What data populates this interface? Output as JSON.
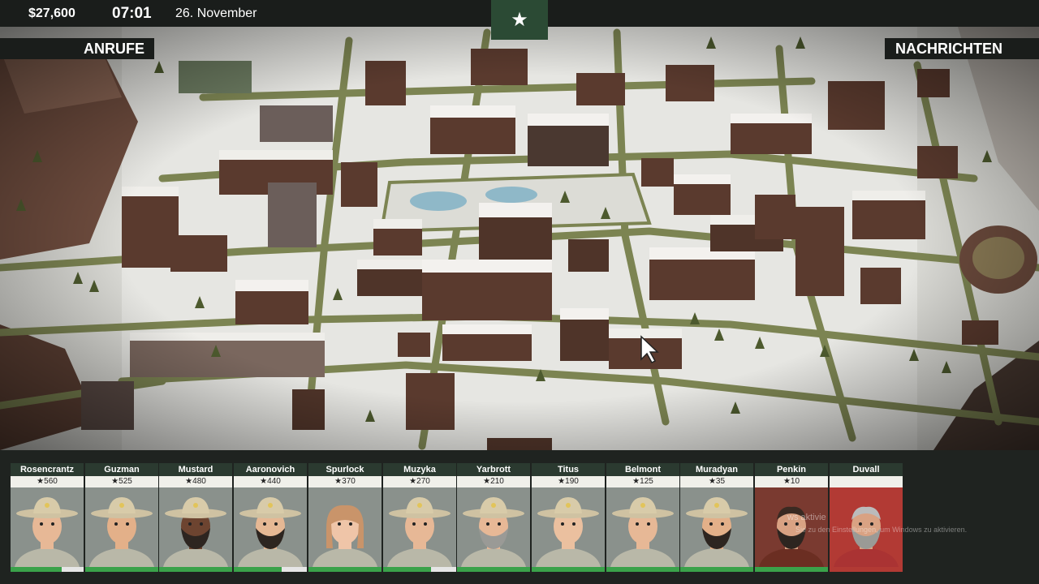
{
  "hud": {
    "money": "$27,600",
    "time": "07:01",
    "date": "26. November",
    "star": "★",
    "calls_label": "ANRUFE",
    "news_label": "NACHRICHTEN"
  },
  "units": [
    {
      "name": "Rosencrantz",
      "score": "★560",
      "progress": 0.7
    },
    {
      "name": "Guzman",
      "score": "★525",
      "progress": 1.0
    },
    {
      "name": "Mustard",
      "score": "★480",
      "progress": 1.0
    },
    {
      "name": "Aaronovich",
      "score": "★440",
      "progress": 0.65
    },
    {
      "name": "Spurlock",
      "score": "★370",
      "progress": 1.0
    },
    {
      "name": "Muzyka",
      "score": "★270",
      "progress": 0.65
    },
    {
      "name": "Yarbrott",
      "score": "★210",
      "progress": 1.0
    },
    {
      "name": "Titus",
      "score": "★190",
      "progress": 1.0
    },
    {
      "name": "Belmont",
      "score": "★125",
      "progress": 1.0
    },
    {
      "name": "Muradyan",
      "score": "★35",
      "progress": 1.0
    },
    {
      "name": "Penkin",
      "score": "★10",
      "progress": 1.0
    },
    {
      "name": "Duvall",
      "score": "",
      "progress": 1.0
    }
  ],
  "watermark": {
    "line1": "ws aktivie",
    "line2": "Sie zu den Einstellungen, um Windows zu aktivieren."
  },
  "colors": {
    "accent": "#2b4a34",
    "progress": "#3aa24a",
    "road": "#7c8452",
    "snow": "#e9e9e6",
    "building": "#5a3a2e"
  }
}
